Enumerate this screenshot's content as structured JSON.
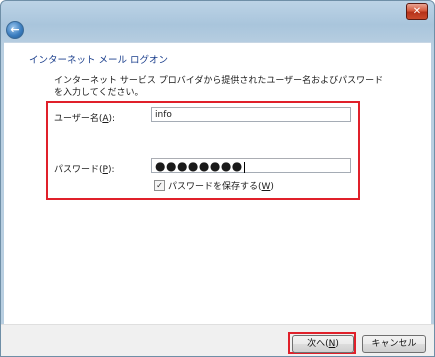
{
  "window": {
    "close_label": "✕",
    "back_glyph": "←"
  },
  "page": {
    "title": "インターネット メール ログオン",
    "instructions": "インターネット サービス プロバイダから提供されたユーザー名およびパスワードを入力してください。"
  },
  "form": {
    "username_label_prefix": "ユーザー名(",
    "username_label_key": "A",
    "username_label_suffix": "):",
    "username_value": "info",
    "password_label_prefix": "パスワード(",
    "password_label_key": "P",
    "password_label_suffix": "):",
    "password_mask": "●●●●●●●●",
    "remember_label_prefix": "パスワードを保存する(",
    "remember_label_key": "W",
    "remember_label_suffix": ")",
    "remember_checked": true,
    "check_glyph": "✓"
  },
  "footer": {
    "next_label_prefix": "次へ(",
    "next_label_key": "N",
    "next_label_suffix": ")",
    "cancel_label": "キャンセル"
  },
  "colors": {
    "highlight": "#e0202a",
    "title_text": "#1a3e8c"
  }
}
